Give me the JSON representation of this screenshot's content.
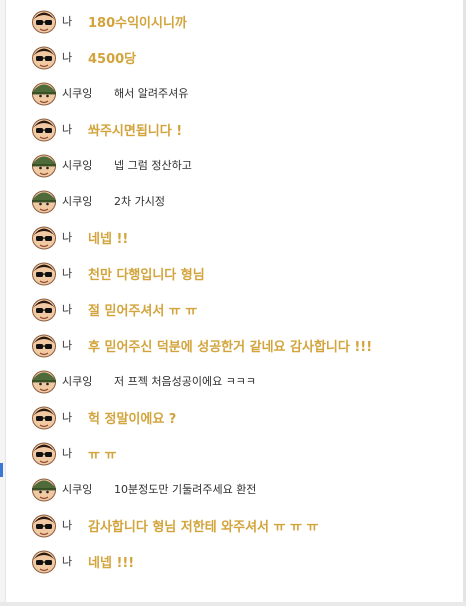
{
  "colors": {
    "my_message": "#d3a43c",
    "other_message": "#303030"
  },
  "messages": [
    {
      "sender": "나",
      "text": "180수익이시니까",
      "mine": true
    },
    {
      "sender": "나",
      "text": "4500당",
      "mine": true
    },
    {
      "sender": "시쿠잉",
      "text": "해서 알려주셔유",
      "mine": false
    },
    {
      "sender": "나",
      "text": "쏴주시면됩니다 !",
      "mine": true
    },
    {
      "sender": "시쿠잉",
      "text": "넵 그럼 정산하고",
      "mine": false
    },
    {
      "sender": "시쿠잉",
      "text": "2차 가시정",
      "mine": false
    },
    {
      "sender": "나",
      "text": "네넵 !!",
      "mine": true
    },
    {
      "sender": "나",
      "text": "천만 다행입니다 형님",
      "mine": true
    },
    {
      "sender": "나",
      "text": "절 믿어주셔서 ㅠ ㅠ",
      "mine": true
    },
    {
      "sender": "나",
      "text": "후 믿어주신 덕분에 성공한거 같네요 감사합니다 !!!",
      "mine": true
    },
    {
      "sender": "시쿠잉",
      "text": "저 프젝 처음성공이에요 ㅋㅋㅋ",
      "mine": false
    },
    {
      "sender": "나",
      "text": "헉 정말이에요 ?",
      "mine": true
    },
    {
      "sender": "나",
      "text": "ㅠ ㅠ",
      "mine": true
    },
    {
      "sender": "시쿠잉",
      "text": "10분정도만 기둘려주세요 환전",
      "mine": false
    },
    {
      "sender": "나",
      "text": "감사합니다 형님 저한테 와주셔서 ㅠ ㅠ ㅠ",
      "mine": true
    },
    {
      "sender": "나",
      "text": "네넵 !!!",
      "mine": true
    }
  ]
}
